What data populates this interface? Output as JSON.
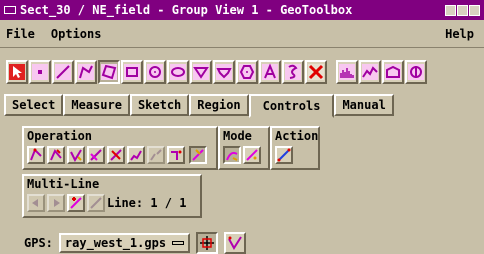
{
  "window": {
    "title": "Sect_30 / NE_field - Group View 1 - GeoToolbox"
  },
  "menu": {
    "file": "File",
    "options": "Options",
    "help": "Help"
  },
  "toolbar": {
    "tools": [
      "select-icon",
      "point-icon",
      "line-icon",
      "polyline-icon",
      "polygon-icon",
      "rectangle-icon",
      "circle-icon",
      "ellipse-icon",
      "regular-polygon-icon",
      "hexagon-icon",
      "text-icon",
      "erase-icon",
      "histogram-icon",
      "profile-icon",
      "scatter-icon",
      "prism-icon"
    ]
  },
  "tabs": [
    "Select",
    "Measure",
    "Sketch",
    "Region",
    "Controls",
    "Manual"
  ],
  "active_tab": "Controls",
  "groups": {
    "operation": {
      "label": "Operation"
    },
    "mode": {
      "label": "Mode"
    },
    "action": {
      "label": "Action"
    },
    "multiline": {
      "label": "Multi-Line",
      "line_text": "Line: 1 / 1"
    }
  },
  "gps": {
    "label": "GPS:",
    "value": "ray_west_1.gps"
  }
}
